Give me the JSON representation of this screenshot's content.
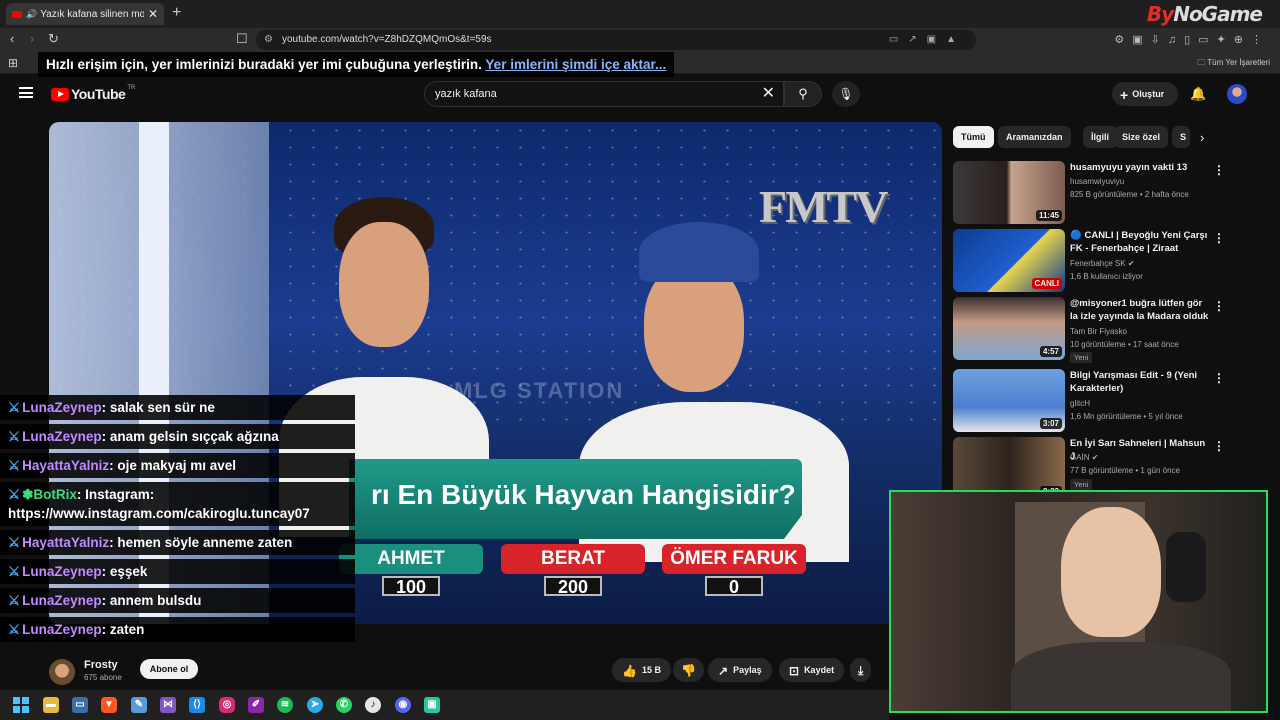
{
  "browser": {
    "tab_title": "Yazık kafana silinen montaj -",
    "url": "youtube.com/watch?v=Z8hDZQMQmOs&t=59s",
    "bookmarks_msg": "Hızlı erişim için, yer imlerinizi buradaki yer imi çubuğuna yerleştirin.",
    "bookmarks_link": "Yer imlerini şimdi içe aktar...",
    "all_bookmarks": "Tüm Yer İşaretleri",
    "watermark_a": "By",
    "watermark_b": "NoGame"
  },
  "youtube": {
    "logo_text": "YouTube",
    "region": "TR",
    "search_value": "yazık kafana",
    "create_label": "Oluştur"
  },
  "video": {
    "brand": "FMTV",
    "overlay_text": "MLG STATION",
    "question": "rı En Büyük Hayvan Hangisidir?",
    "scores": [
      {
        "name": "AHMET",
        "points": "100",
        "color": "#1a8f7e"
      },
      {
        "name": "BERAT",
        "points": "200",
        "color": "#d8232a"
      },
      {
        "name": "ÖMER FARUK",
        "points": "0",
        "color": "#d8232a"
      }
    ]
  },
  "chat": [
    {
      "user": "LunaZeynep",
      "text": "salak sen sür ne"
    },
    {
      "user": "LunaZeynep",
      "text": "anam gelsin sıççak ağzına"
    },
    {
      "user": "HayattaYalniz",
      "text": "oje makyaj mı avel"
    },
    {
      "user": "BotRix",
      "text": "Instagram: https://www.instagram.com/cakiroglu.tuncay07",
      "bot": true
    },
    {
      "user": "HayattaYalniz",
      "text": "hemen söyle anneme zaten"
    },
    {
      "user": "LunaZeynep",
      "text": "eşşek"
    },
    {
      "user": "LunaZeynep",
      "text": "annem bulsdu"
    },
    {
      "user": "LunaZeynep",
      "text": "zaten"
    }
  ],
  "channel": {
    "name": "Frosty",
    "subs": "675 abone",
    "subscribe": "Abone ol"
  },
  "actions": {
    "likes": "15 B",
    "share": "Paylaş",
    "save": "Kaydet"
  },
  "chips": [
    "Tümü",
    "Aramanızdan",
    "İlgili",
    "Size özel",
    "S"
  ],
  "recommendations": [
    {
      "title": "husamyuyu yayın vakti 13",
      "channel": "husamwiyuviyu",
      "meta": "825 B görüntüleme • 2 hafta önce",
      "duration": "11:45"
    },
    {
      "title": "🔵 CANLI | Beyoğlu Yeni Çarşı FK - Fenerbahçe | Ziraat Türkiy...",
      "channel": "Fenerbahçe SK ✔",
      "meta": "1,6 B kullanıcı izliyor",
      "live": "CANLI"
    },
    {
      "title": "@misyoner1  buğra lütfen gör la izle yayında la Madara olduk ...",
      "channel": "Tam Bir Fiyasko",
      "meta": "10 görüntüleme • 17 saat önce",
      "duration": "4:57",
      "badge": "Yeni"
    },
    {
      "title": "Bilgi Yarışması Edit - 9 (Yeni Karakterler)",
      "channel": "glitcH",
      "meta": "1,6 Mn görüntüleme • 5 yıl önce",
      "duration": "3:07"
    },
    {
      "title": "En İyi Sarı Sahneleri | Mahsun J",
      "channel": "GAİN ✔",
      "meta": "77 B görüntüleme • 1 gün önce",
      "duration": "8:23",
      "badge": "Yeni"
    }
  ]
}
